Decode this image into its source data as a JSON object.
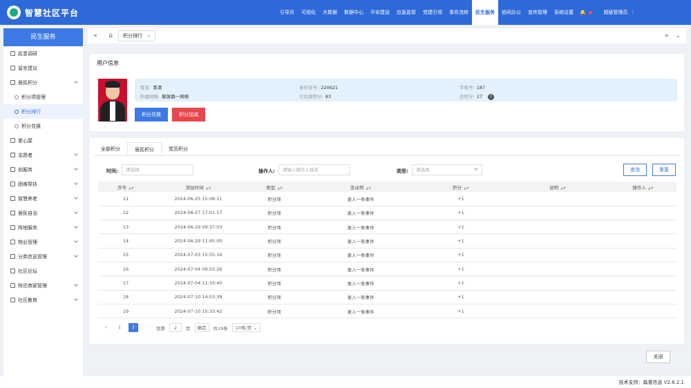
{
  "app": {
    "title": "智慧社区平台"
  },
  "topnav": [
    "引导页",
    "可视化",
    "大数据",
    "数据中心",
    "平安建设",
    "应急监管",
    "党建引领",
    "事件流转",
    "民生服务",
    "协同办公",
    "宣传管理",
    "系统设置"
  ],
  "topnav_active": "民生服务",
  "top_user": "超级管理员",
  "sidebar": {
    "header": "民生服务",
    "items": [
      {
        "label": "民意调研",
        "icon": "doc-icon"
      },
      {
        "label": "留言建议",
        "icon": "chat-icon"
      },
      {
        "label": "居民积分",
        "icon": "doc-icon",
        "expanded": true
      },
      {
        "label": "积分项管理",
        "sub": true
      },
      {
        "label": "积分排行",
        "sub": true,
        "selected": true
      },
      {
        "label": "积分兑换",
        "sub": true
      },
      {
        "label": "爱心屋",
        "icon": "flag-icon"
      },
      {
        "label": "志愿者",
        "icon": "users-icon",
        "expandable": true
      },
      {
        "label": "创服务",
        "icon": "grid-icon",
        "expandable": true
      },
      {
        "label": "困难帮扶",
        "icon": "doc-icon",
        "expandable": true
      },
      {
        "label": "智慧养老",
        "icon": "doc-icon",
        "expandable": true
      },
      {
        "label": "居民自治",
        "icon": "doc-icon",
        "expandable": true
      },
      {
        "label": "阵地服务",
        "icon": "doc-icon",
        "expandable": true
      },
      {
        "label": "物业管理",
        "icon": "doc-icon",
        "expandable": true
      },
      {
        "label": "分类信息管理",
        "icon": "doc-icon",
        "expandable": true
      },
      {
        "label": "社区论坛",
        "icon": "doc-icon"
      },
      {
        "label": "附近商家管理",
        "icon": "doc-icon",
        "expandable": true
      },
      {
        "label": "社区教育",
        "icon": "doc-icon",
        "expandable": true
      }
    ]
  },
  "tabbar": {
    "tab": "积分排行"
  },
  "user_card": {
    "title": "用户信息",
    "name_label": "姓名:",
    "name": "李清",
    "grid_label": "所属网格:",
    "grid": "解放路一网格",
    "id_label": "身份证号:",
    "id": "220621",
    "redeemed_label": "已兑换积分:",
    "redeemed": "83",
    "phone_label": "手机号:",
    "phone": "187",
    "total_label": "总积分:",
    "total": "27",
    "btn_redeem": "积分兑换",
    "btn_add": "积分加减"
  },
  "tabs": [
    "全部积分",
    "居民积分",
    "党员积分"
  ],
  "tabs_active": 1,
  "filters": {
    "time_label": "时间:",
    "time_placeholder": "请选择",
    "operator_label": "操作人:",
    "operator_placeholder": "请输入操作人姓名",
    "type_label": "类型:",
    "type_placeholder": "请选择",
    "query": "查询",
    "reset": "重置"
  },
  "table": {
    "columns": [
      "序号",
      "添加时间",
      "类型",
      "变动项",
      "积分",
      "说明",
      "操作人"
    ],
    "rows": [
      [
        "11",
        "2024-06-25 15:08:11",
        "积分项",
        "录入一条事件",
        "+1",
        "",
        ""
      ],
      [
        "12",
        "2024-06-27 17:01:17",
        "积分项",
        "录入一条事件",
        "+1",
        "",
        ""
      ],
      [
        "13",
        "2024-06-29 09:37:03",
        "积分项",
        "录入一条事件",
        "+1",
        "",
        ""
      ],
      [
        "14",
        "2024-06-29 11:45:00",
        "积分项",
        "录入一条事件",
        "+1",
        "",
        ""
      ],
      [
        "15",
        "2024-07-03 15:55:19",
        "积分项",
        "录入一条事件",
        "+1",
        "",
        ""
      ],
      [
        "16",
        "2024-07-04 09:02:26",
        "积分项",
        "录入一条事件",
        "+1",
        "",
        ""
      ],
      [
        "17",
        "2024-07-04 11:33:40",
        "积分项",
        "录入一条事件",
        "+1",
        "",
        ""
      ],
      [
        "18",
        "2024-07-10 14:53:39",
        "积分项",
        "录入一条事件",
        "+1",
        "",
        ""
      ],
      [
        "19",
        "2024-07-10 15:33:42",
        "积分项",
        "录入一条事件",
        "+1",
        "",
        ""
      ]
    ]
  },
  "pager": {
    "page1": "1",
    "page2": "2",
    "goto_label": "到第",
    "goto_value": "2",
    "page_unit": "页",
    "confirm": "确定",
    "total": "共19条",
    "per_page": "10条/页"
  },
  "close_btn": "关闭",
  "footer": "技术支持：森普信息  V2.6.2.1"
}
